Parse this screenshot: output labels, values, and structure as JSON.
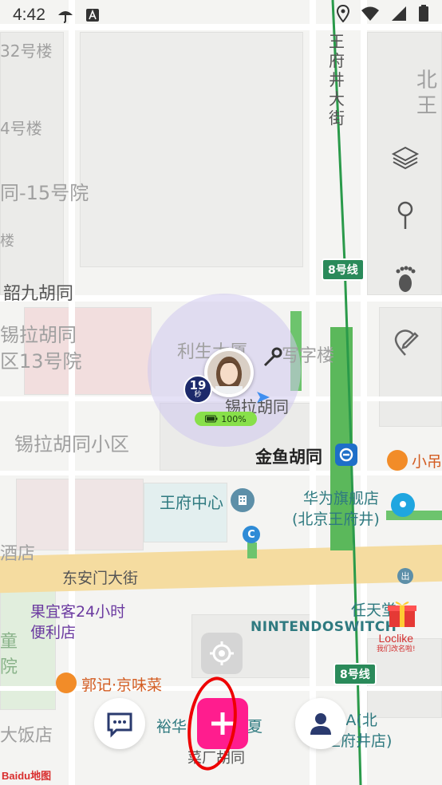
{
  "status_bar": {
    "time": "4:42"
  },
  "map": {
    "labels": {
      "l1": "32号楼",
      "l2": "4号楼",
      "l3": "同-15号院",
      "l4": "楼",
      "l5": "韶九胡同",
      "l6": "锡拉胡同",
      "l7": "区13号院",
      "l8": "锡拉胡同小区",
      "l9": "利生大厦",
      "l10": "写字楼",
      "l11": "锡拉胡同",
      "l12": "金鱼胡同",
      "l13": "小吊",
      "l14": "王府中心",
      "l15": "华为旗舰店",
      "l16": "(北京王府井)",
      "l17": "酒店",
      "l18": "东安门大街",
      "l19": "果宜客24小时",
      "l20": "便利店",
      "l21": "任天堂",
      "l22": "NINTENDOSWITCH",
      "l23": "童",
      "l24": "院",
      "l25": "郭记·京味菜",
      "l26": "大饭店",
      "l27": "裕华",
      "l28": "夏",
      "l29": "菜厂胡同",
      "l30": "ARA(北",
      "l31": "王府井店)",
      "l32": "北",
      "l33": "王",
      "street": "王府井大街"
    },
    "metro": {
      "line_label": "8号线"
    }
  },
  "user_marker": {
    "seconds": "19",
    "seconds_unit": "秒",
    "battery": "100%"
  },
  "loclike": {
    "name": "Loclike",
    "tagline": "我们改名啦!"
  },
  "logo": {
    "text": "Baidu地图"
  },
  "colors": {
    "accent": "#ff1d8e",
    "metro": "#2a8a5a",
    "annotation": "#ee0000"
  }
}
